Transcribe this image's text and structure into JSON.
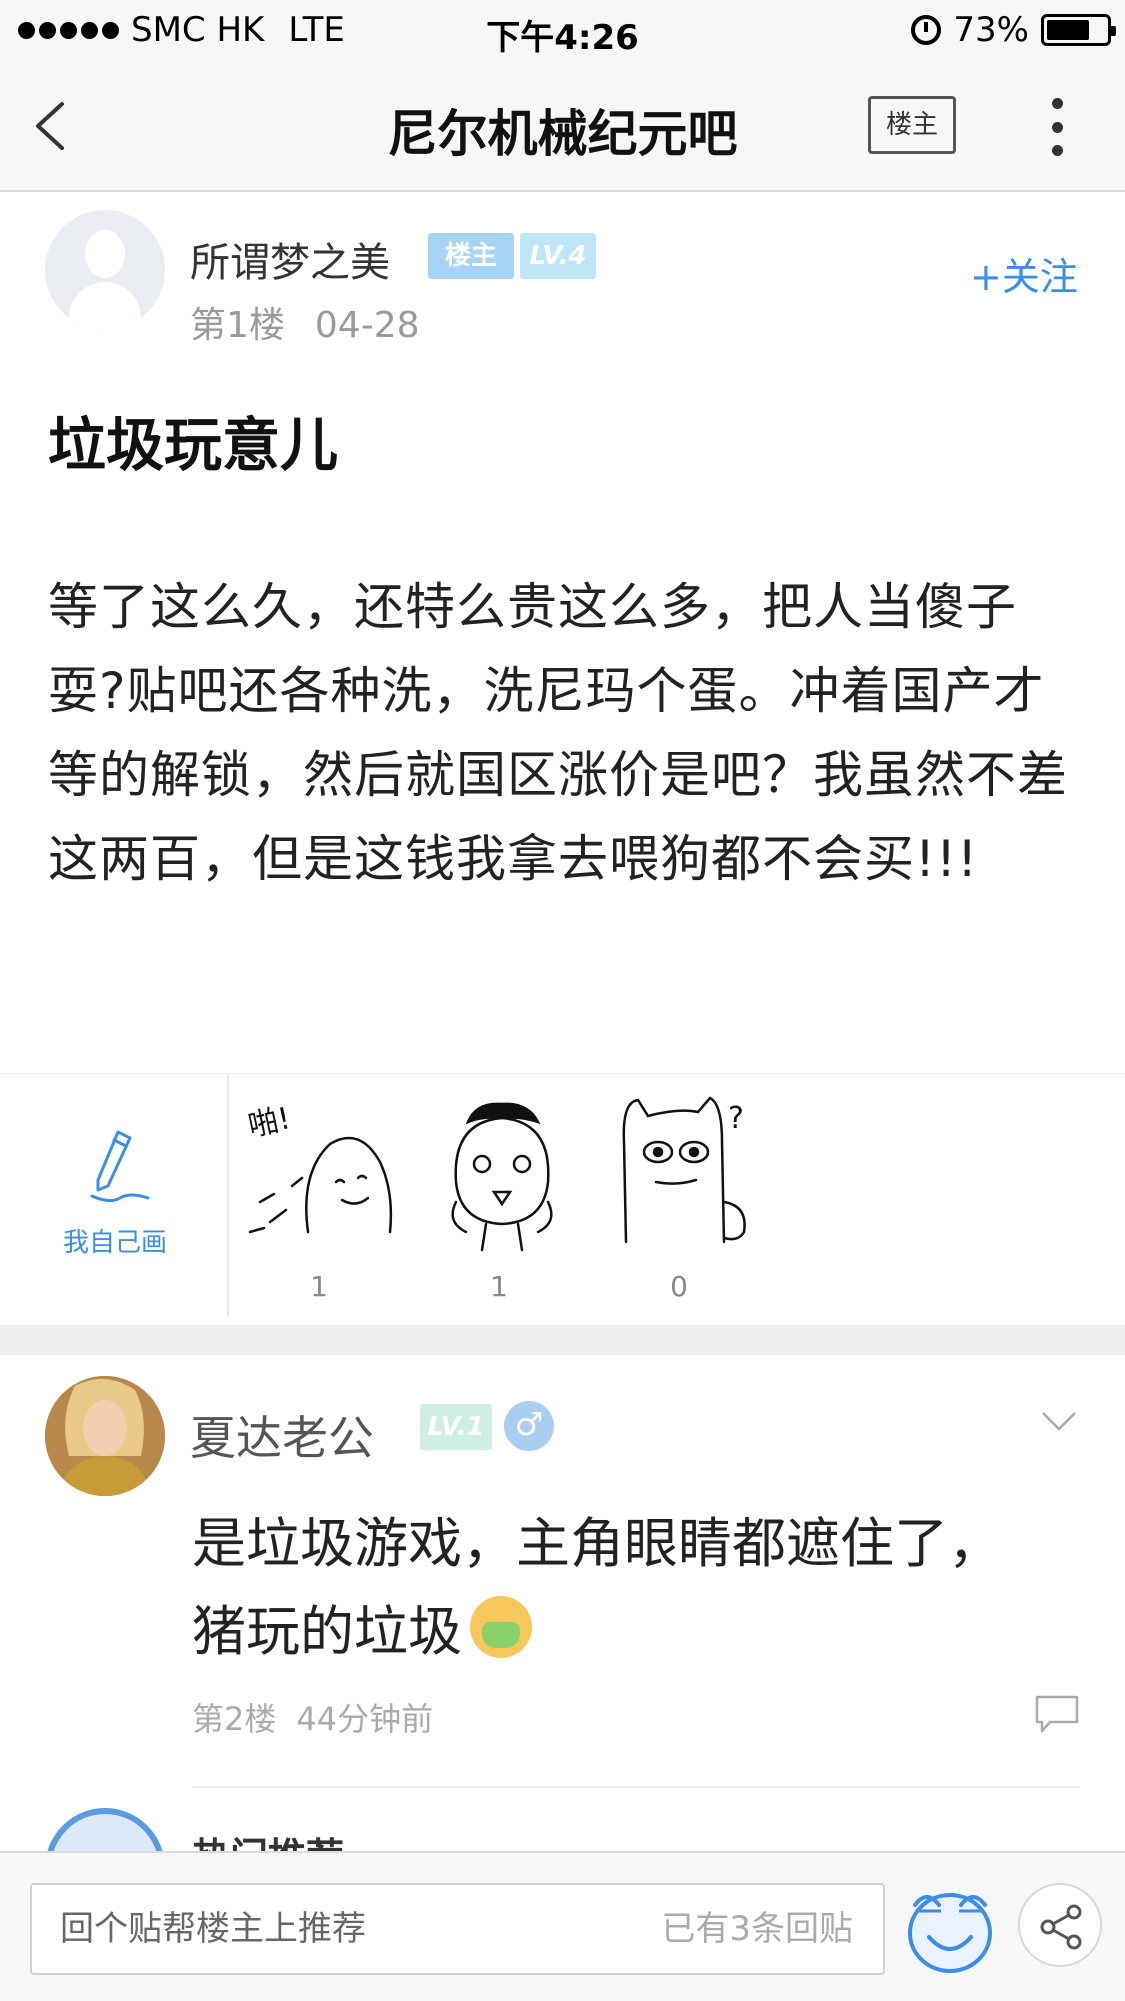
{
  "status_bar": {
    "carrier": "SMC HK",
    "network": "LTE",
    "time": "下午4:26",
    "battery": "73%",
    "battery_level": 0.73
  },
  "nav": {
    "title": "尼尔机械纪元吧",
    "op_only_label": "楼主"
  },
  "post": {
    "author": "所谓梦之美",
    "op_badge": "楼主",
    "level_badge": "LV.4",
    "floor": "第1楼",
    "date": "04-28",
    "follow_label": "+关注",
    "title": "垃圾玩意儿",
    "body": "等了这么久，还特么贵这么多，把人当傻子耍?贴吧还各种洗，洗尼玛个蛋。冲着国产才等的解锁，然后就国区涨价是吧？我虽然不差这两百，但是这钱我拿去喂狗都不会买!!!"
  },
  "stickers": {
    "draw_label": "我自己画",
    "items": [
      {
        "caption": "啪!",
        "count": "1"
      },
      {
        "caption": "",
        "count": "1"
      },
      {
        "caption": "?",
        "count": "0"
      }
    ]
  },
  "reply": {
    "author": "夏达老公",
    "level_badge": "LV.1",
    "gender_symbol": "♂",
    "body": "是垃圾游戏，主角眼睛都遮住了，猪玩的垃圾",
    "floor": "第2楼",
    "time": "44分钟前"
  },
  "peek": {
    "label": "热门推荐"
  },
  "bottom_bar": {
    "input_placeholder": "回个贴帮楼主上推荐",
    "reply_count": "已有3条回贴"
  },
  "colors": {
    "accent": "#3a8ee6",
    "op_badge": "#a7d3f5",
    "level_badge": "#bfe6f7",
    "level_badge_reply": "#cfeee3",
    "meta_text": "#9a9a9a"
  }
}
